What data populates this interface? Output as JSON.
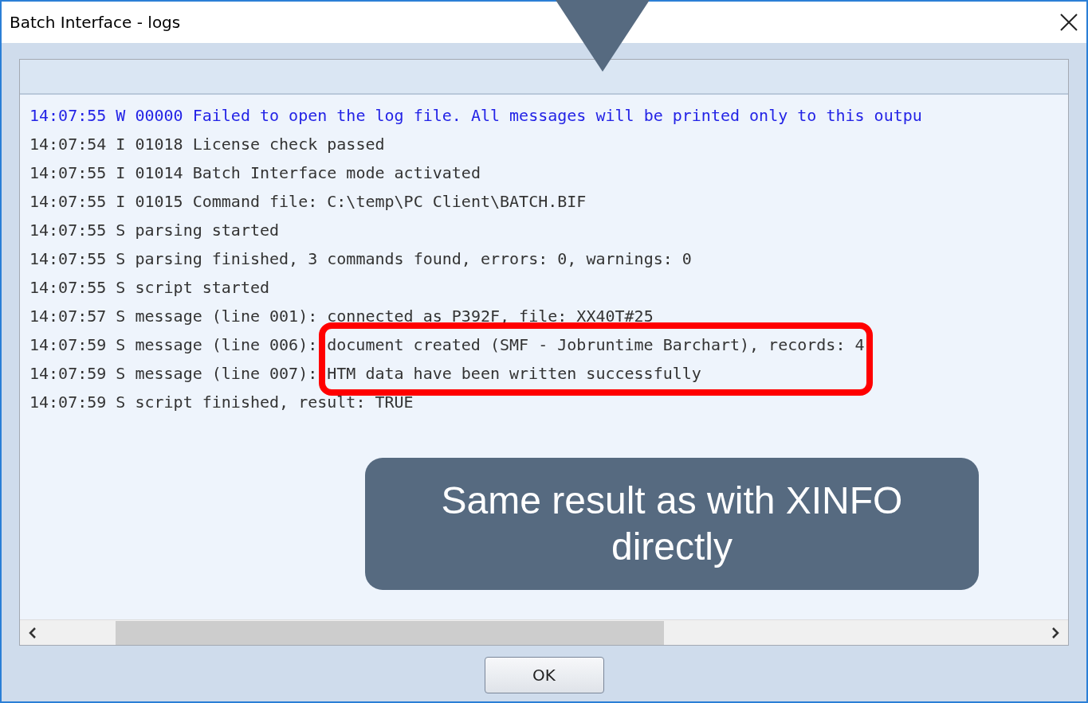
{
  "window": {
    "title": "Batch Interface - logs"
  },
  "log": {
    "lines": [
      {
        "kind": "warning",
        "text": "14:07:55 W 00000 Failed to open the log file. All messages will be printed only to this outpu"
      },
      {
        "kind": "info",
        "text": "14:07:54 I 01018 License check passed"
      },
      {
        "kind": "info",
        "text": "14:07:55 I 01014 Batch Interface mode activated"
      },
      {
        "kind": "info",
        "text": "14:07:55 I 01015 Command file: C:\\temp\\PC Client\\BATCH.BIF"
      },
      {
        "kind": "info",
        "text": "14:07:55 S parsing started"
      },
      {
        "kind": "info",
        "text": "14:07:55 S parsing finished, 3 commands found, errors: 0, warnings: 0"
      },
      {
        "kind": "info",
        "text": "14:07:55 S script started"
      },
      {
        "kind": "info",
        "text": "14:07:57 S message (line 001): connected as P392F, file: XX40T#25"
      },
      {
        "kind": "info",
        "highlighted": true,
        "prefix": "14:07:59 S message (line 006):",
        "text": "document created (SMF - Jobruntime Barchart), records: 4"
      },
      {
        "kind": "info",
        "highlighted": true,
        "prefix": "14:07:59 S message (line 007):",
        "text": "HTM data have been written successfully"
      },
      {
        "kind": "info",
        "text": "14:07:59 S script finished, result: TRUE"
      }
    ]
  },
  "callout": {
    "text": "Same result as with XINFO directly"
  },
  "buttons": [
    {
      "label": "OK"
    }
  ]
}
